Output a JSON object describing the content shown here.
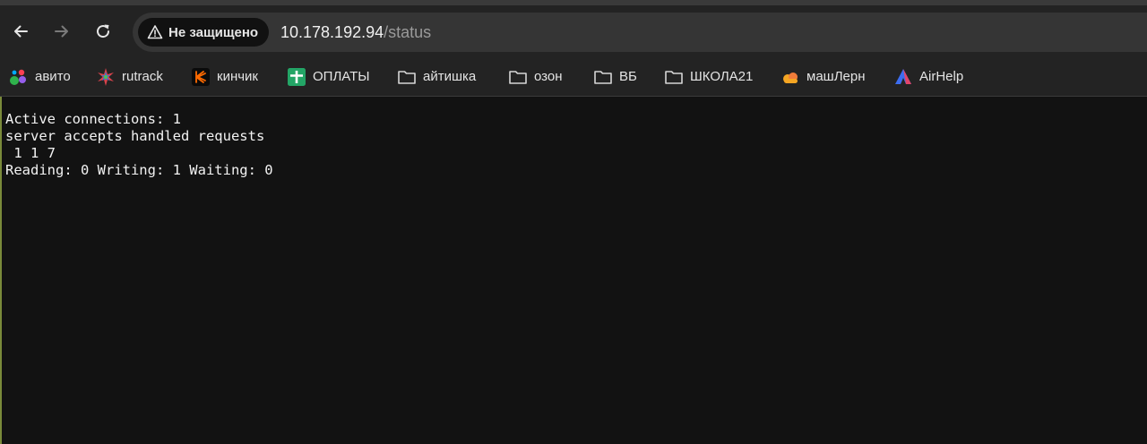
{
  "toolbar": {
    "back_icon": "arrow-left-icon",
    "forward_icon": "arrow-right-icon",
    "reload_icon": "reload-icon",
    "security_icon": "warning-triangle-icon",
    "security_label": "Не защищено",
    "url_host": "10.178.192.94",
    "url_path": "/status"
  },
  "bookmarks": {
    "items": [
      {
        "label": "авито",
        "icon": "avito-icon"
      },
      {
        "label": "rutrack",
        "icon": "rutrack-icon"
      },
      {
        "label": "кинчик",
        "icon": "kinopoisk-icon"
      },
      {
        "label": "ОПЛАТЫ",
        "icon": "sheets-icon"
      },
      {
        "label": "айтишка",
        "icon": "folder-icon"
      },
      {
        "label": "озон",
        "icon": "folder-icon"
      },
      {
        "label": "ВБ",
        "icon": "folder-icon"
      },
      {
        "label": "ШКОЛА21",
        "icon": "folder-icon"
      },
      {
        "label": "машЛерн",
        "icon": "cloud-icon"
      },
      {
        "label": "AirHelp",
        "icon": "airhelp-icon"
      }
    ]
  },
  "content": {
    "lines": [
      "Active connections: 1 ",
      "server accepts handled requests",
      " 1 1 7 ",
      "Reading: 0 Writing: 1 Waiting: 0 "
    ]
  },
  "colors": {
    "background": "#121212",
    "toolbar": "#232323",
    "omnibox": "#353535",
    "text": "#f2f2f2"
  }
}
